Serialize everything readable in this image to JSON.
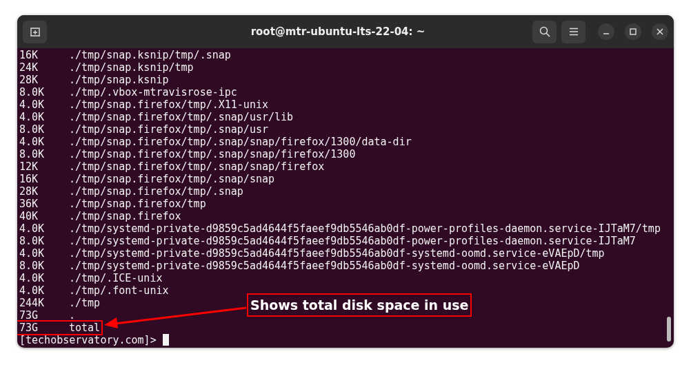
{
  "window": {
    "title": "root@mtr-ubuntu-lts-22-04: ~"
  },
  "lines": [
    {
      "size": "16K",
      "path": "./tmp/snap.ksnip/tmp/.snap",
      "highlighted": false
    },
    {
      "size": "24K",
      "path": "./tmp/snap.ksnip/tmp",
      "highlighted": false
    },
    {
      "size": "28K",
      "path": "./tmp/snap.ksnip",
      "highlighted": false
    },
    {
      "size": "8.0K",
      "path": "./tmp/.vbox-mtravisrose-ipc",
      "highlighted": false
    },
    {
      "size": "4.0K",
      "path": "./tmp/snap.firefox/tmp/.X11-unix",
      "highlighted": false
    },
    {
      "size": "4.0K",
      "path": "./tmp/snap.firefox/tmp/.snap/usr/lib",
      "highlighted": false
    },
    {
      "size": "8.0K",
      "path": "./tmp/snap.firefox/tmp/.snap/usr",
      "highlighted": false
    },
    {
      "size": "4.0K",
      "path": "./tmp/snap.firefox/tmp/.snap/snap/firefox/1300/data-dir",
      "highlighted": false
    },
    {
      "size": "8.0K",
      "path": "./tmp/snap.firefox/tmp/.snap/snap/firefox/1300",
      "highlighted": false
    },
    {
      "size": "12K",
      "path": "./tmp/snap.firefox/tmp/.snap/snap/firefox",
      "highlighted": false
    },
    {
      "size": "16K",
      "path": "./tmp/snap.firefox/tmp/.snap/snap",
      "highlighted": false
    },
    {
      "size": "28K",
      "path": "./tmp/snap.firefox/tmp/.snap",
      "highlighted": false
    },
    {
      "size": "36K",
      "path": "./tmp/snap.firefox/tmp",
      "highlighted": false
    },
    {
      "size": "40K",
      "path": "./tmp/snap.firefox",
      "highlighted": false
    },
    {
      "size": "4.0K",
      "path": "./tmp/systemd-private-d9859c5ad4644f5faeef9db5546ab0df-power-profiles-daemon.service-IJTaM7/tmp",
      "highlighted": false
    },
    {
      "size": "8.0K",
      "path": "./tmp/systemd-private-d9859c5ad4644f5faeef9db5546ab0df-power-profiles-daemon.service-IJTaM7",
      "highlighted": false
    },
    {
      "size": "4.0K",
      "path": "./tmp/systemd-private-d9859c5ad4644f5faeef9db5546ab0df-systemd-oomd.service-eVAEpD/tmp",
      "highlighted": false
    },
    {
      "size": "8.0K",
      "path": "./tmp/systemd-private-d9859c5ad4644f5faeef9db5546ab0df-systemd-oomd.service-eVAEpD",
      "highlighted": false
    },
    {
      "size": "4.0K",
      "path": "./tmp/.ICE-unix",
      "highlighted": false
    },
    {
      "size": "4.0K",
      "path": "./tmp/.font-unix",
      "highlighted": false
    },
    {
      "size": "244K",
      "path": "./tmp",
      "highlighted": false
    },
    {
      "size": "73G",
      "path": ".",
      "highlighted": false
    },
    {
      "size": "73G",
      "path": "total",
      "highlighted": true
    }
  ],
  "prompt": "[techobservatory.com]>",
  "annotation": {
    "text": "Shows total disk space in use"
  }
}
